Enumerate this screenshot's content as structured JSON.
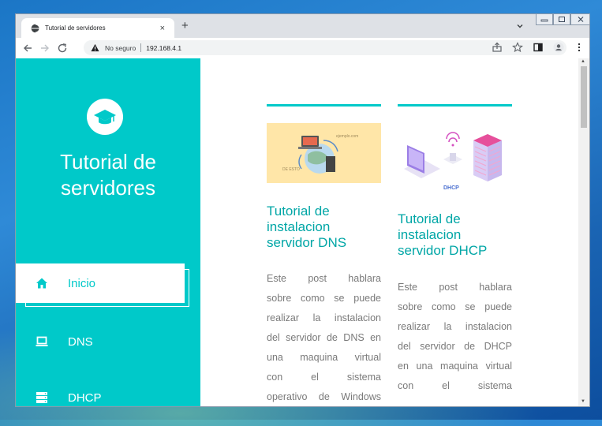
{
  "browser": {
    "tab_title": "Tutorial de servidores",
    "tab_close": "×",
    "new_tab": "+",
    "insecure_label": "No seguro",
    "url": "192.168.4.1"
  },
  "site": {
    "title_line1": "Tutorial de",
    "title_line2": "servidores",
    "accent_color": "#00c9c9",
    "nav": [
      {
        "label": "Inicio",
        "icon": "home-icon",
        "active": true
      },
      {
        "label": "DNS",
        "icon": "laptop-icon",
        "active": false
      },
      {
        "label": "DHCP",
        "icon": "server-icon",
        "active": false
      }
    ]
  },
  "posts": [
    {
      "title_lines": [
        "Tutorial de",
        "instalacion",
        "servidor DNS"
      ],
      "excerpt_lines": [
        "Este post hablara",
        "sobre como se puede",
        "realizar la instalacion",
        "del servidor de DNS en",
        "una maquina virtual",
        "con el sistema",
        "operativo de Windows"
      ],
      "thumb_text_1": "DE ESTO",
      "thumb_text_2": "ejemplo.com"
    },
    {
      "title_lines": [
        "Tutorial de",
        "instalacion",
        "servidor DHCP"
      ],
      "excerpt_lines": [
        "Este post hablara",
        "sobre como se puede",
        "realizar la instalacion",
        "del servidor de DHCP",
        "en una maquina virtual",
        "con el sistema"
      ],
      "thumb_label": "DHCP"
    }
  ]
}
